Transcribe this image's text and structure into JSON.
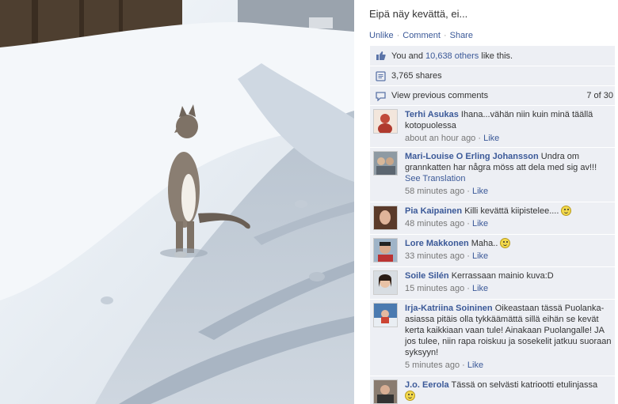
{
  "post": {
    "caption": "Eipä näy kevättä, ei...",
    "actions": [
      "Unlike",
      "Comment",
      "Share"
    ],
    "likes_prefix": "You and ",
    "likes_link": "10,638 others",
    "likes_suffix": " like this.",
    "shares": "3,765 shares",
    "view_previous": "View previous comments",
    "comment_count": "7 of 30"
  },
  "comments": [
    {
      "name": "Terhi Asukas",
      "text": "Ihana...vähän niin kuin minä täällä kotopuolessa",
      "time": "about an hour ago",
      "like": "Like"
    },
    {
      "name": "Mari-Louise O Erling Johansson",
      "text": "Undra om grannkatten har några möss att dela med sig av!!!",
      "translate": "See Translation",
      "time": "58 minutes ago",
      "like": "Like"
    },
    {
      "name": "Pia Kaipainen",
      "text": "Killi kevättä kiipistelee....",
      "smiley": true,
      "time": "48 minutes ago",
      "like": "Like"
    },
    {
      "name": "Lore Makkonen",
      "text": "Maha..",
      "smiley": true,
      "time": "33 minutes ago",
      "like": "Like"
    },
    {
      "name": "Soile Silén",
      "text": "Kerrassaan mainio kuva:D",
      "time": "15 minutes ago",
      "like": "Like"
    },
    {
      "name": "Irja-Katriina Soininen",
      "text": "Oikeastaan tässä Puolanka-asiassa pitäis olla tykkäämättä sillä eihän se kevät kerta kaikkiaan vaan tule! Ainakaan Puolangalle! JA jos tulee, niin rapa roiskuu ja sosekelit jatkuu suoraan syksyyn!",
      "time": "5 minutes ago",
      "like": "Like"
    },
    {
      "name": "J.o. Eerola",
      "text": "Tässä on selvästi katriootti etulinjassa",
      "smiley": true,
      "time": "",
      "like": ""
    }
  ],
  "colors": {
    "link": "#3b5998",
    "panel": "#edeff4"
  }
}
